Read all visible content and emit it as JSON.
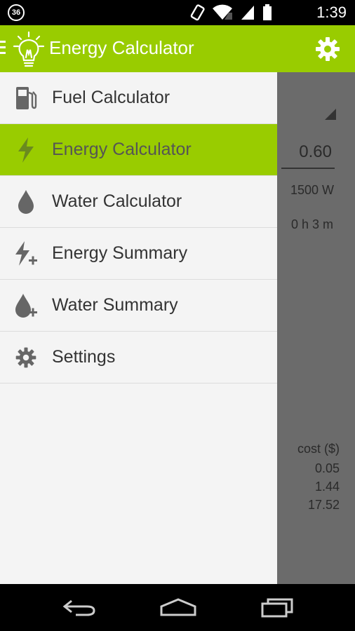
{
  "status": {
    "badge": "36",
    "time": "1:39"
  },
  "app": {
    "title": "Energy Calculator"
  },
  "drawer": {
    "items": [
      {
        "label": "Fuel Calculator",
        "icon": "fuel-pump-icon",
        "active": false
      },
      {
        "label": "Energy Calculator",
        "icon": "lightning-icon",
        "active": true
      },
      {
        "label": "Water Calculator",
        "icon": "water-drop-icon",
        "active": false
      },
      {
        "label": "Energy Summary",
        "icon": "lightning-plus-icon",
        "active": false
      },
      {
        "label": "Water Summary",
        "icon": "water-drop-plus-icon",
        "active": false
      },
      {
        "label": "Settings",
        "icon": "gear-icon",
        "active": false
      }
    ]
  },
  "background": {
    "rate_value": "0.60",
    "power": "1500 W",
    "duration": "0 h 3 m",
    "cost_header": "cost ($)",
    "costs": [
      "0.05",
      "1.44",
      "17.52"
    ]
  },
  "colors": {
    "accent": "#99cc00",
    "scrim": "#6b6b6b",
    "drawer_bg": "#f4f4f4"
  }
}
